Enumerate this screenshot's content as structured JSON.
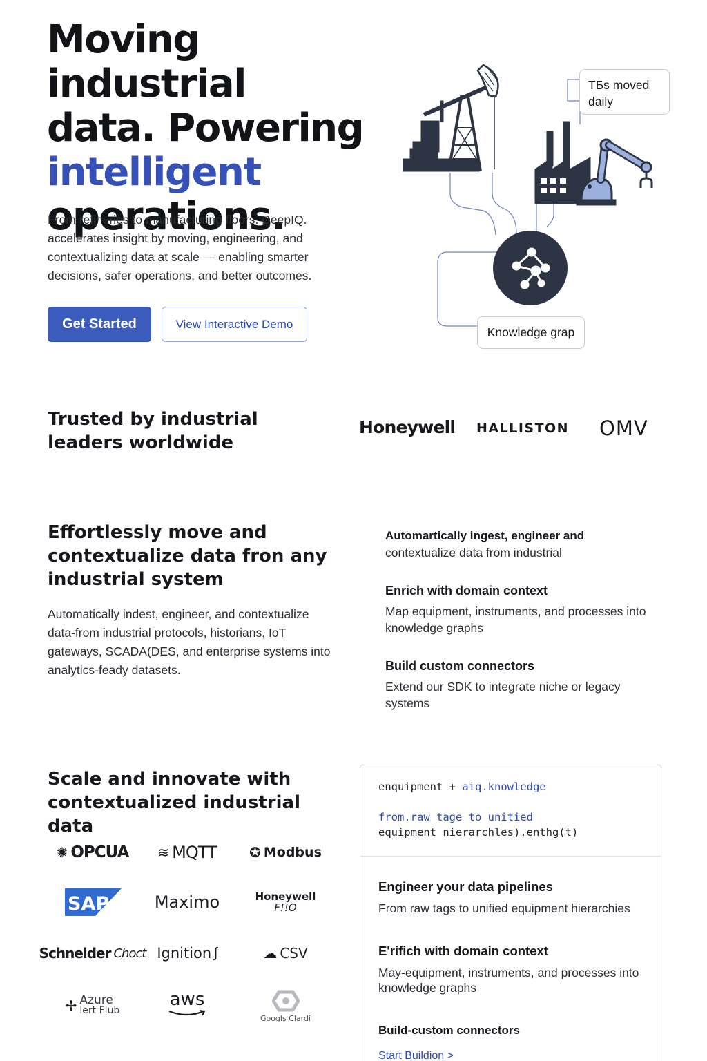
{
  "hero": {
    "title_line1": "Moving industrial",
    "title_line2": "data. Powering",
    "title_accent": "intelligent",
    "title_line4": "operations.",
    "description": "From refineries to manufacturing floors. DeepIQ. accelerates insight by moving, engineering, and contextualizing data at scale — enabling smarter decisions, safer operations, and better outcomes.",
    "primary_button": "Get Started",
    "secondary_button": "View Interactive Demo",
    "callout_tb": "TБs moved daily",
    "callout_kg": "Knowledge grap",
    "accent_color": "#3551b8"
  },
  "trusted": {
    "title": "Trusted by industrial leaders worldwide",
    "logos": [
      "Honeywell",
      "HALLISTON",
      "OMV"
    ]
  },
  "section2": {
    "title": "Effortlessly move and contextualize data fron any industrial system",
    "description": "Automatically indest, engineer, and contextualize data-from industrial protocols, historians, IoT gateways, SCADA(DES, and enterprise systems into analytics-feady datasets.",
    "features": [
      {
        "title": "Automartically ingest, engineer and",
        "desc": "contextualize data from industrial"
      },
      {
        "title": "Enrich with domain context",
        "desc": "Map equipment, instruments, and processes into knowledge graphs"
      },
      {
        "title": "Build custom connectors",
        "desc": "Extend our SDK to integrate niche or legacy systems"
      }
    ]
  },
  "section3": {
    "title": "Scale and innovate with contextualized industrial data",
    "integrations": {
      "opcua": "OPCUA",
      "mqtt": "MQTT",
      "modbus": "Modbus",
      "sap": "SAP",
      "maximo": "Maximo",
      "honeywell_f": "Honeywell",
      "honeywell_f_sub": "F!!O",
      "schneider": "Schnelder",
      "schneider_sub": "Choct",
      "ignition": "Ignition",
      "csv": "CSV",
      "azure": "Azure",
      "azure_sub": "lert Flub",
      "aws": "aws",
      "google": "Googls Clardi"
    },
    "code": {
      "line1_a": "enquipment + ",
      "line1_b": "aiq.knowledge",
      "line2": "from.raw tage to unitied",
      "line3": "equipment nierarchles).enthg(t)"
    },
    "panel_features": [
      {
        "title": "Engineer your data pipelines",
        "desc": "From raw tags to unified equipment hierarchies"
      },
      {
        "title": "E'rifich with domain context",
        "desc": "May-equipment, instruments, and processes into knowledge graphs"
      },
      {
        "title": "Build-custom connectors",
        "desc": ""
      }
    ],
    "panel_link": "Start Buildion >"
  }
}
